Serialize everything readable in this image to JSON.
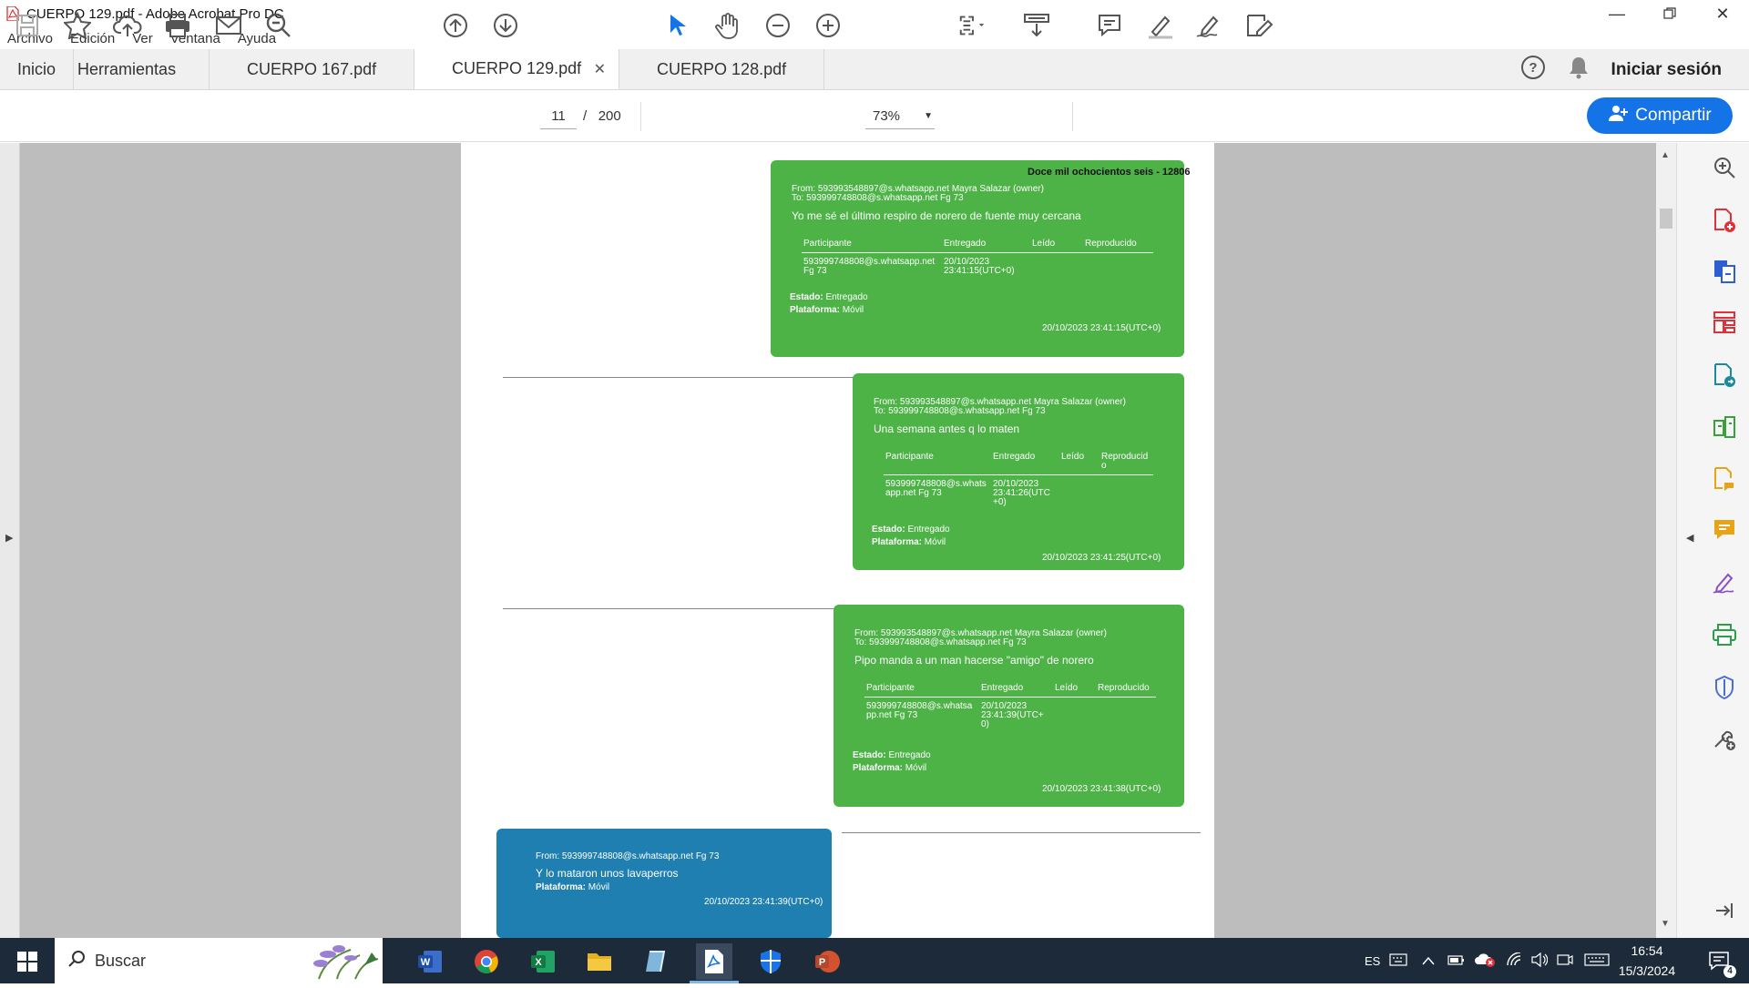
{
  "window": {
    "title": "CUERPO 129.pdf - Adobe Acrobat Pro DC"
  },
  "menu": [
    "Archivo",
    "Edición",
    "Ver",
    "Ventana",
    "Ayuda"
  ],
  "tabs": {
    "home": "Inicio",
    "tools": "Herramientas",
    "docs": [
      "CUERPO 167.pdf",
      "CUERPO 129.pdf",
      "CUERPO 128.pdf"
    ],
    "active_doc": 1
  },
  "header": {
    "signin": "Iniciar sesión"
  },
  "toolbar": {
    "page_current": "11",
    "page_sep": "/",
    "page_total": "200",
    "zoom": "73%",
    "share_label": "Compartir"
  },
  "document": {
    "stamp": "Doce mil ochocientos seis - 12806",
    "messages": [
      {
        "from": "From: 593993548897@s.whatsapp.net Mayra Salazar (owner)",
        "to": "To: 593999748808@s.whatsapp.net Fg 73",
        "text": "Yo me sé el último respiro de norero  de fuente muy cercana",
        "h_participante": "Participante",
        "h_entregado": "Entregado",
        "h_leido": "Leído",
        "h_reproducido": "Reproducido",
        "participant_1": "593999748808@s.whatsapp.net",
        "participant_2": "Fg 73",
        "delivered_1": "20/10/2023",
        "delivered_2": "23:41:15(UTC+0)",
        "estado_label": "Estado:",
        "estado": "Entregado",
        "plataforma_label": "Plataforma:",
        "plataforma": "Móvil",
        "timestamp": "20/10/2023 23:41:15(UTC+0)"
      },
      {
        "from": "From: 593993548897@s.whatsapp.net Mayra Salazar (owner)",
        "to": "To: 593999748808@s.whatsapp.net Fg 73",
        "text": "Una semana antes q lo maten",
        "h_participante": "Participante",
        "h_entregado": "Entregado",
        "h_leido": "Leído",
        "h_reproducido": "Reproducid",
        "h_reproducido_2": "o",
        "participant_1": "593999748808@s.whats",
        "participant_2": "app.net Fg 73",
        "delivered_1": "20/10/2023",
        "delivered_2": "23:41:26(UTC",
        "delivered_3": "+0)",
        "estado_label": "Estado:",
        "estado": "Entregado",
        "plataforma_label": "Plataforma:",
        "plataforma": "Móvil",
        "timestamp": "20/10/2023 23:41:25(UTC+0)"
      },
      {
        "from": "From: 593993548897@s.whatsapp.net Mayra Salazar (owner)",
        "to": "To: 593999748808@s.whatsapp.net Fg 73",
        "text": "Pipo manda a un man hacerse \"amigo\" de norero",
        "h_participante": "Participante",
        "h_entregado": "Entregado",
        "h_leido": "Leído",
        "h_reproducido": "Reproducido",
        "participant_1": "593999748808@s.whatsa",
        "participant_2": "pp.net Fg 73",
        "delivered_1": "20/10/2023",
        "delivered_2": "23:41:39(UTC+",
        "delivered_3": "0)",
        "estado_label": "Estado:",
        "estado": "Entregado",
        "plataforma_label": "Plataforma:",
        "plataforma": "Móvil",
        "timestamp": "20/10/2023 23:41:38(UTC+0)"
      },
      {
        "from": "From: 593999748808@s.whatsapp.net Fg 73",
        "text": "Y lo mataron unos lavaperros",
        "plataforma_label": "Plataforma:",
        "plataforma": "Móvil",
        "timestamp": "20/10/2023 23:41:39(UTC+0)"
      }
    ]
  },
  "taskbar": {
    "search_placeholder": "Buscar",
    "lang": "ES",
    "time": "16:54",
    "date": "15/3/2024",
    "notif_count": "4"
  },
  "colors": {
    "accent": "#1473e6",
    "bubble_green": "#4db347",
    "bubble_blue": "#1f7fb0",
    "taskbar": "#1c2a3a"
  }
}
